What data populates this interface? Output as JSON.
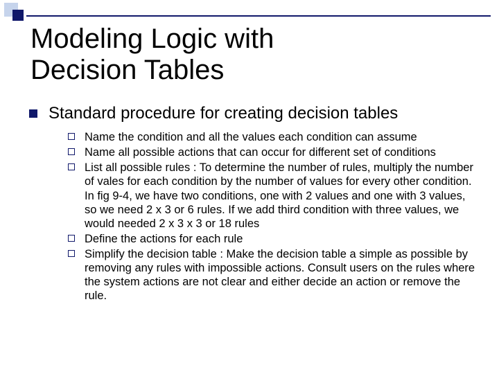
{
  "title_line1": "Modeling Logic with",
  "title_line2": "Decision Tables",
  "heading": "Standard procedure for creating decision tables",
  "items": [
    "Name the condition and all the values each condition can assume",
    "Name all possible actions that can occur for different set of conditions",
    "List all possible rules : To determine the number of rules, multiply the number of vales for each condition by the number of values for every other condition. In fig 9-4, we have two conditions, one with 2 values and one with 3 values, so we need 2 x 3  or 6 rules. If we add third condition with three values, we would needed 2 x 3 x 3 or 18 rules",
    "Define the actions for each rule",
    "Simplify the decision table : Make the decision table a simple as possible by removing any rules with impossible actions. Consult users on the rules where the system actions are not clear and either decide an action or remove the rule."
  ]
}
